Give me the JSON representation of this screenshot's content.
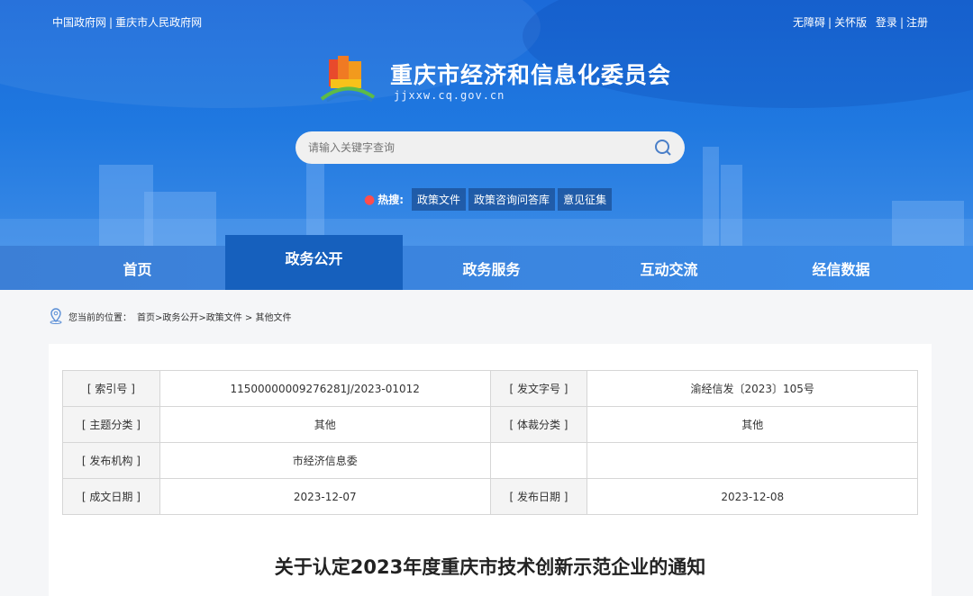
{
  "top_left_links": [
    "中国政府网",
    "重庆市人民政府网"
  ],
  "top_right_links": [
    "无障碍",
    "关怀版",
    "登录",
    "注册"
  ],
  "site": {
    "title": "重庆市经济和信息化委员会",
    "domain": "jjxxw.cq.gov.cn"
  },
  "search": {
    "placeholder": "请输入关键字查询"
  },
  "hot": {
    "label": "热搜:",
    "tags": [
      "政策文件",
      "政策咨询问答库",
      "意见征集"
    ]
  },
  "nav": [
    "首页",
    "政务公开",
    "政务服务",
    "互动交流",
    "经信数据"
  ],
  "breadcrumb": {
    "label": "您当前的位置：",
    "path": "首页>政务公开>政策文件 > 其他文件"
  },
  "meta": [
    [
      "[ 索引号 ]",
      "11500000009276281J/2023-01012",
      "[ 发文字号 ]",
      "渝经信发〔2023〕105号"
    ],
    [
      "[ 主题分类 ]",
      "其他",
      "[ 体裁分类 ]",
      "其他"
    ],
    [
      "[ 发布机构 ]",
      "市经济信息委",
      "",
      ""
    ],
    [
      "[ 成文日期 ]",
      "2023-12-07",
      "[ 发布日期 ]",
      "2023-12-08"
    ]
  ],
  "doc_title": "关于认定2023年度重庆市技术创新示范企业的通知"
}
